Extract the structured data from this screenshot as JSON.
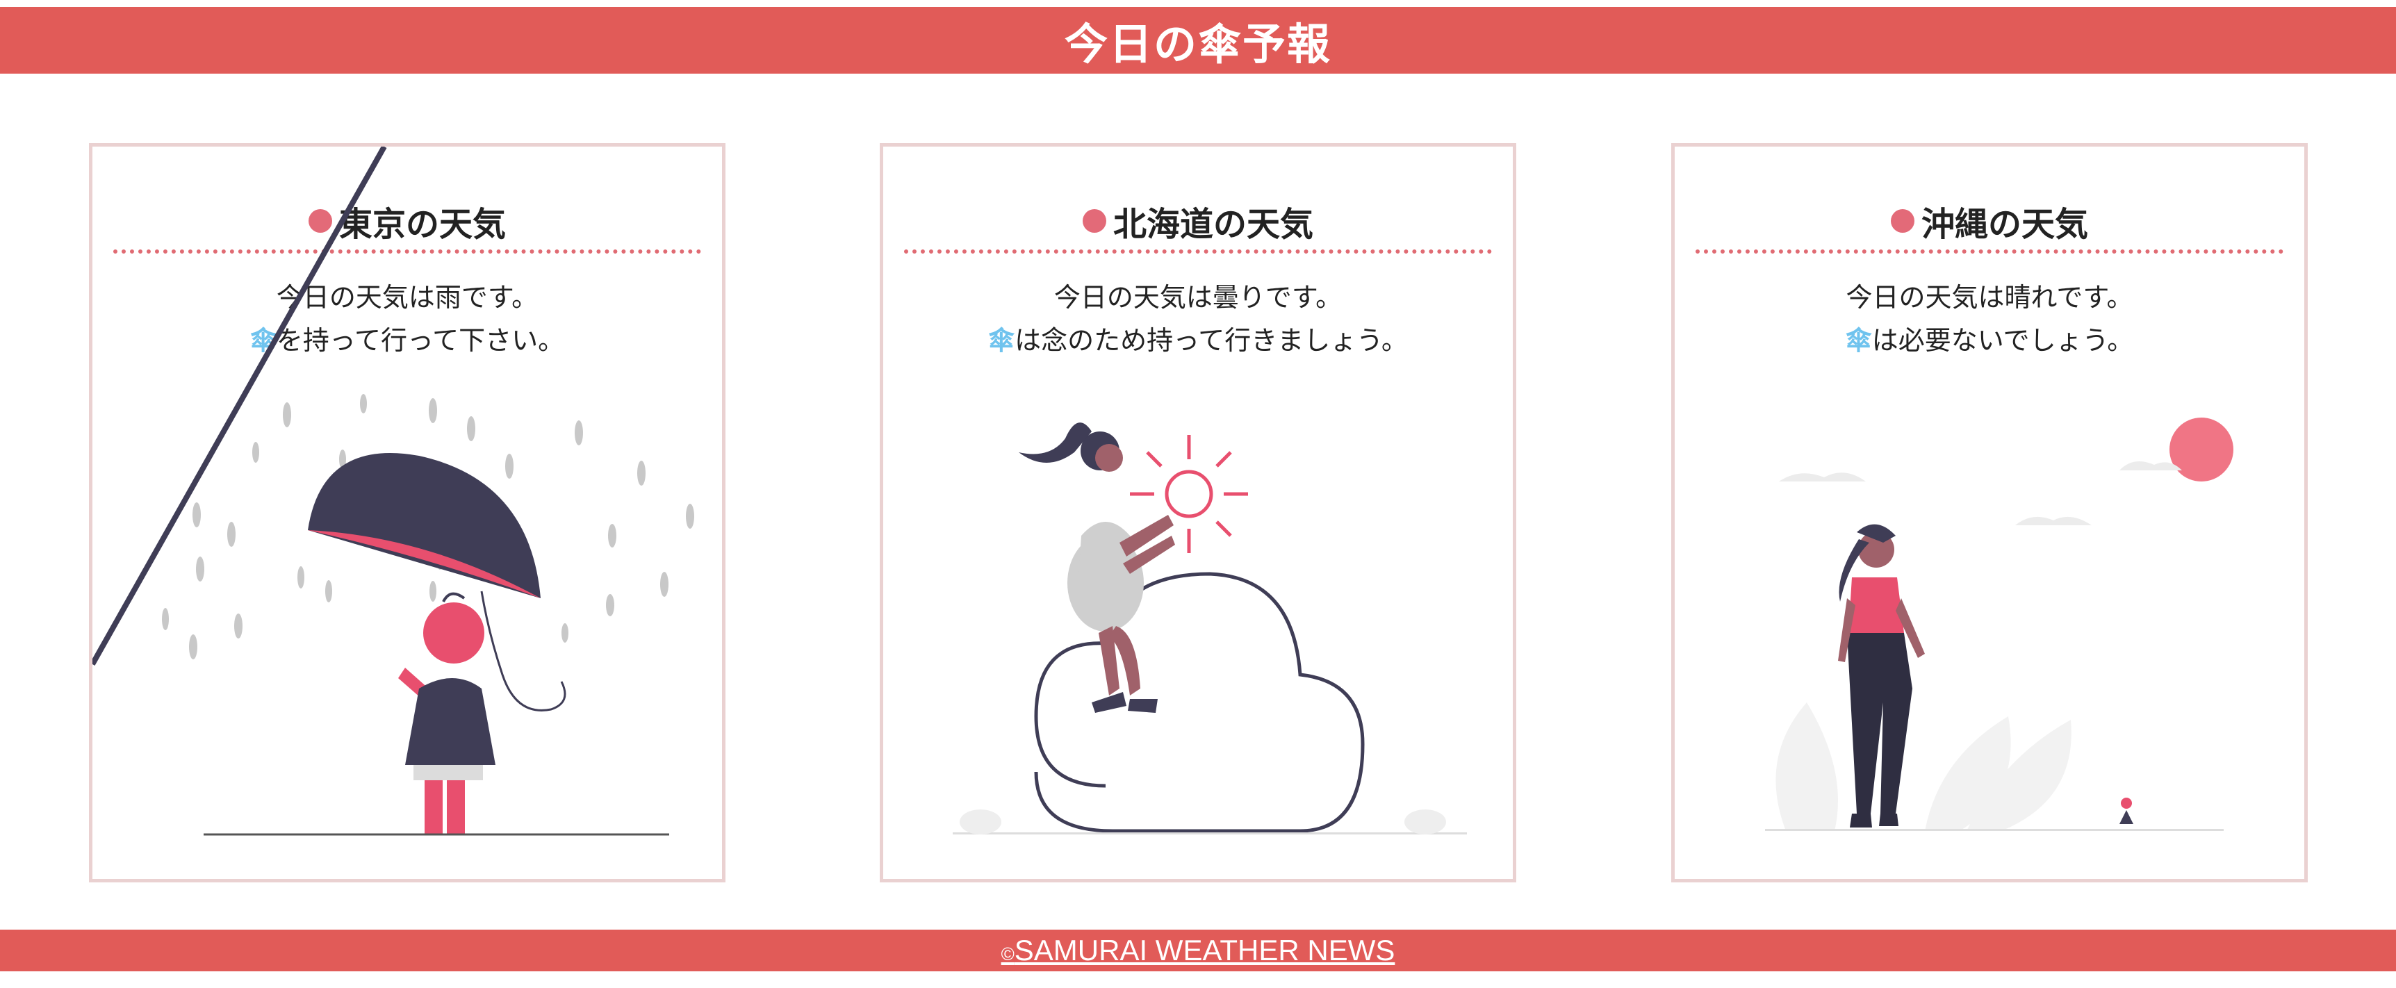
{
  "header": {
    "title": "今日の傘予報"
  },
  "cards": [
    {
      "title": "東京の天気",
      "line1": "今日の天気は雨です。",
      "line2_icon": "傘",
      "line2_text": "を持って行って下さい。",
      "illustration": "rain-umbrella-illustration"
    },
    {
      "title": "北海道の天気",
      "line1": "今日の天気は曇りです。",
      "line2_icon": "傘",
      "line2_text": "は念のため持って行きましょう。",
      "illustration": "cloud-sun-illustration"
    },
    {
      "title": "沖縄の天気",
      "line1": "今日の天気は晴れです。",
      "line2_icon": "傘",
      "line2_text": "は必要ないでしょう。",
      "illustration": "sunny-walk-illustration"
    }
  ],
  "footer": {
    "copyright_symbol": "©",
    "link_text": "SAMURAI WEATHER NEWS"
  },
  "colors": {
    "accent": "#e15b58",
    "pink": "#e36a78",
    "card_border": "#ead1d1",
    "umbrella_icon": "#6fc3ee",
    "dark": "#3f3d56"
  }
}
